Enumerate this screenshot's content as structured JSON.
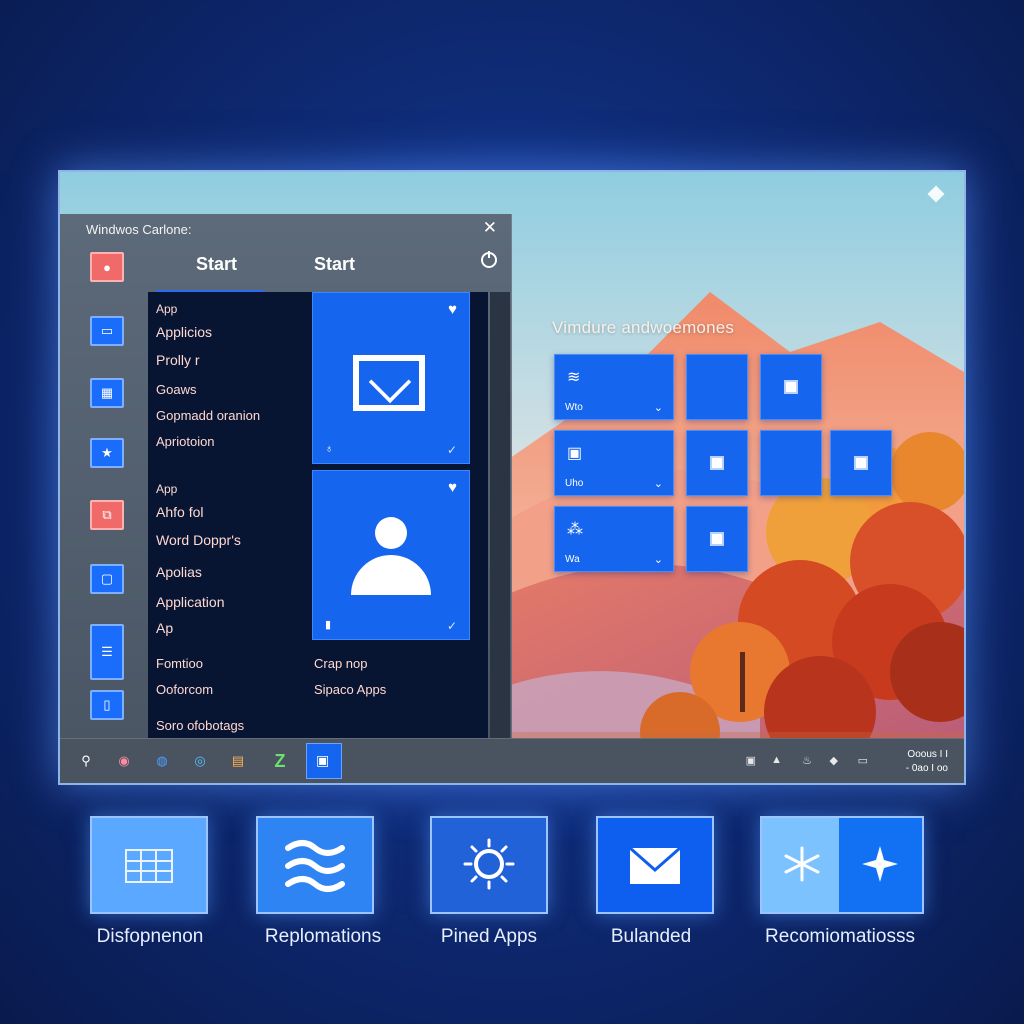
{
  "start_menu": {
    "header": "Windwos Carlone:",
    "tabs": [
      "Start",
      "Start"
    ],
    "app_list": [
      "App",
      "Applicios",
      "Prolly r",
      "Goaws",
      "Gopmadd oranion",
      "Apriotoion",
      "App",
      "Ahfo fol",
      "Word Doppr's",
      "Apolias",
      "Application",
      "Ap"
    ],
    "footer_left": [
      "Fomtioo",
      "Ooforcom",
      "Soro ofobotags"
    ],
    "footer_right": [
      "Crap nop",
      "Sipaco Apps"
    ]
  },
  "widgets": {
    "title": "Vimdure andwoemones",
    "tile_labels": [
      "Wto",
      "Uho",
      "Wa"
    ]
  },
  "taskbar": {
    "clock_line1": "Ooous I I",
    "clock_line2": "- 0ao  I oo"
  },
  "features": [
    {
      "label": "Disfopnenon",
      "icon": "grid-icon"
    },
    {
      "label": "Replomations",
      "icon": "waves-icon"
    },
    {
      "label": "Pined Apps",
      "icon": "sun-icon"
    },
    {
      "label": "Bulanded",
      "icon": "mail-icon"
    },
    {
      "label": "Recomiomatiosss",
      "icon": "snowflake-icon"
    }
  ],
  "colors": {
    "accent": "#1565ee",
    "background": "#0f2c78",
    "start_bg": "#4a5664"
  }
}
